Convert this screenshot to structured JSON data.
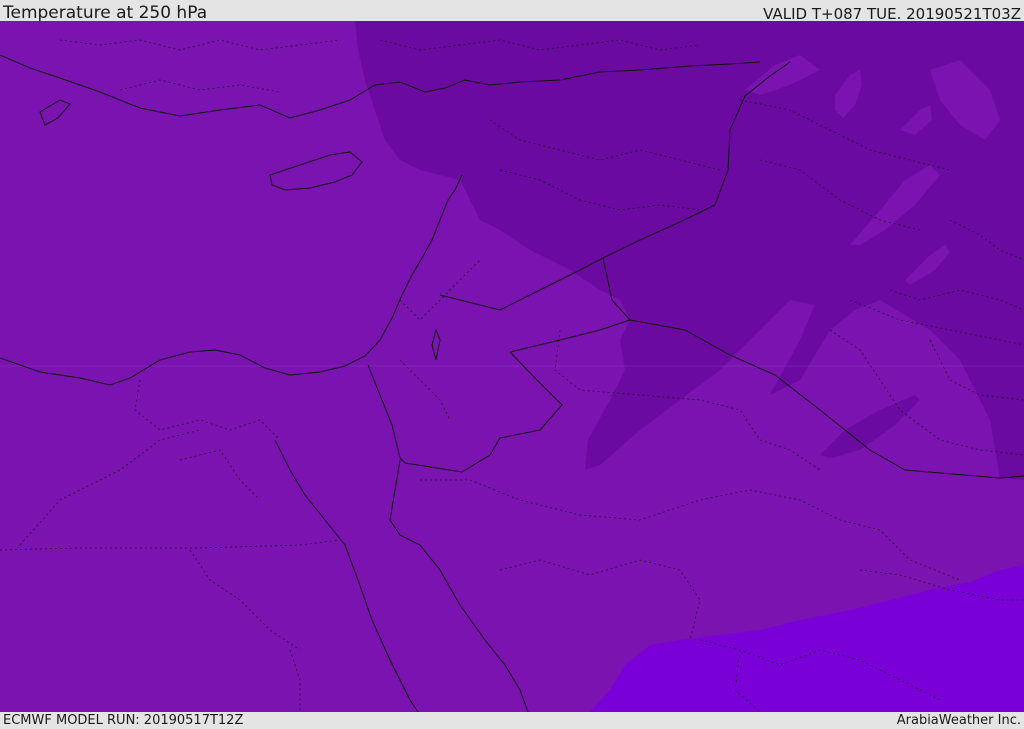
{
  "header": {
    "title": "Temperature at 250 hPa",
    "valid": "VALID T+087 TUE. 20190521T03Z"
  },
  "footer": {
    "model_run": "ECMWF MODEL RUN: 20190517T12Z",
    "credit": "ArabiaWeather Inc."
  },
  "map": {
    "colors": {
      "base": "#7a13b0",
      "cold": "#6a0aa0",
      "warm": "#7a00d8",
      "borders": "#111111",
      "grid": "#9a55c8"
    }
  }
}
